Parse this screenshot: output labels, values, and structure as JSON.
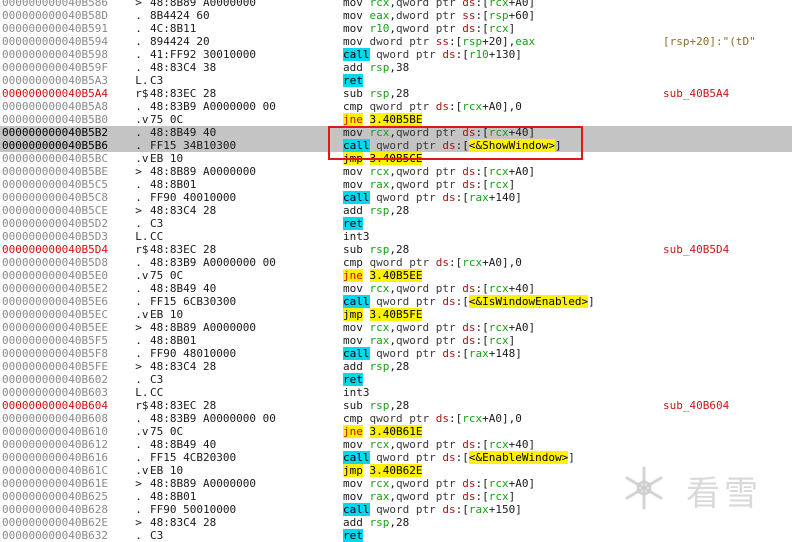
{
  "watermark": "看雪",
  "rows": [
    {
      "addr": "000000000040B586",
      "bytes": "48:8B89 A0000000",
      "g": "  >",
      "asm": [
        [
          "mov",
          "m"
        ],
        [
          " "
        ],
        [
          "rcx",
          "reg"
        ],
        [
          ","
        ],
        [
          "qword ptr ",
          "kw"
        ],
        [
          "ds",
          "seg"
        ],
        [
          ":["
        ],
        [
          "rcx",
          "reg"
        ],
        [
          "+A0]"
        ]
      ]
    },
    {
      "addr": "000000000040B58D",
      "bytes": "8B4424 60",
      "g": "  .",
      "asm": [
        [
          "mov",
          "m"
        ],
        [
          " "
        ],
        [
          "eax",
          "reg"
        ],
        [
          ","
        ],
        [
          "dword ptr ",
          "kw"
        ],
        [
          "ss",
          "seg"
        ],
        [
          ":["
        ],
        [
          "rsp",
          "reg"
        ],
        [
          "+60]"
        ]
      ]
    },
    {
      "addr": "000000000040B591",
      "bytes": "4C:8B11",
      "g": "  .",
      "asm": [
        [
          "mov",
          "m"
        ],
        [
          " "
        ],
        [
          "r10",
          "reg"
        ],
        [
          ","
        ],
        [
          "qword ptr ",
          "kw"
        ],
        [
          "ds",
          "seg"
        ],
        [
          ":["
        ],
        [
          "rcx",
          "reg"
        ],
        [
          "]"
        ]
      ]
    },
    {
      "addr": "000000000040B594",
      "bytes": "894424 20",
      "g": "  .",
      "asm": [
        [
          "mov",
          "m"
        ],
        [
          " "
        ],
        [
          "dword ptr ",
          "kw"
        ],
        [
          "ss",
          "seg"
        ],
        [
          ":["
        ],
        [
          "rsp",
          "reg"
        ],
        [
          "+20],"
        ],
        [
          "eax",
          "reg"
        ]
      ],
      "cmt": "[rsp+20]:\"(tD\""
    },
    {
      "addr": "000000000040B598",
      "bytes": "41:FF92 30010000",
      "g": "  .",
      "asm": [
        [
          "call",
          "call"
        ],
        [
          " "
        ],
        [
          "qword ptr ",
          "kw"
        ],
        [
          "ds",
          "seg"
        ],
        [
          ":["
        ],
        [
          "r10",
          "reg"
        ],
        [
          "+130]"
        ]
      ]
    },
    {
      "addr": "000000000040B59F",
      "bytes": "48:83C4 38",
      "g": "  .",
      "asm": [
        [
          "add",
          "m"
        ],
        [
          " "
        ],
        [
          "rsp",
          "reg"
        ],
        [
          ",38"
        ]
      ]
    },
    {
      "addr": "000000000040B5A3",
      "bytes": "C3",
      "g": "  L.",
      "asm": [
        [
          "ret",
          "ret"
        ]
      ]
    },
    {
      "addr": "000000000040B5A4",
      "bytes": "48:83EC 28",
      "g": "  r$",
      "lbl": true,
      "asm": [
        [
          "sub",
          "m"
        ],
        [
          " "
        ],
        [
          "rsp",
          "reg"
        ],
        [
          ",28"
        ]
      ],
      "cmt": "sub_40B5A4",
      "cmtfn": true
    },
    {
      "addr": "000000000040B5A8",
      "bytes": "48:83B9 A0000000 00",
      "g": "  .",
      "asm": [
        [
          "cmp",
          "m"
        ],
        [
          " "
        ],
        [
          "qword ptr ",
          "kw"
        ],
        [
          "ds",
          "seg"
        ],
        [
          ":["
        ],
        [
          "rcx",
          "reg"
        ],
        [
          "+A0],0"
        ]
      ]
    },
    {
      "addr": "000000000040B5B0",
      "bytes": "75 0C",
      "g": "  .v",
      "asm": [
        [
          "jne",
          "jcc"
        ],
        [
          " "
        ],
        [
          "3.40B5BE",
          "op"
        ]
      ]
    },
    {
      "addr": "000000000040B5B2",
      "bytes": "48:8B49 40",
      "g": "  .",
      "sel": true,
      "asm": [
        [
          "mov",
          "m"
        ],
        [
          " "
        ],
        [
          "rcx",
          "reg"
        ],
        [
          ","
        ],
        [
          "qword ptr ",
          "kw"
        ],
        [
          "ds",
          "seg"
        ],
        [
          ":["
        ],
        [
          "rcx",
          "reg"
        ],
        [
          "+40]"
        ]
      ]
    },
    {
      "addr": "000000000040B5B6",
      "bytes": "FF15 34B10300",
      "g": "  .",
      "sel": true,
      "asm": [
        [
          "call",
          "call"
        ],
        [
          " "
        ],
        [
          "qword ptr ",
          "kw"
        ],
        [
          "ds",
          "seg"
        ],
        [
          ":["
        ],
        [
          "<&ShowWindow>",
          "op"
        ],
        [
          "]"
        ]
      ]
    },
    {
      "addr": "000000000040B5BC",
      "bytes": "EB 10",
      "g": "  .v",
      "asm": [
        [
          "jmp",
          "jmp"
        ],
        [
          " "
        ],
        [
          "3.40B5CE",
          "op"
        ]
      ]
    },
    {
      "addr": "000000000040B5BE",
      "bytes": "48:8B89 A0000000",
      "g": "  >",
      "asm": [
        [
          "mov",
          "m"
        ],
        [
          " "
        ],
        [
          "rcx",
          "reg"
        ],
        [
          ","
        ],
        [
          "qword ptr ",
          "kw"
        ],
        [
          "ds",
          "seg"
        ],
        [
          ":["
        ],
        [
          "rcx",
          "reg"
        ],
        [
          "+A0]"
        ]
      ]
    },
    {
      "addr": "000000000040B5C5",
      "bytes": "48:8B01",
      "g": "  .",
      "asm": [
        [
          "mov",
          "m"
        ],
        [
          " "
        ],
        [
          "rax",
          "reg"
        ],
        [
          ","
        ],
        [
          "qword ptr ",
          "kw"
        ],
        [
          "ds",
          "seg"
        ],
        [
          ":["
        ],
        [
          "rcx",
          "reg"
        ],
        [
          "]"
        ]
      ]
    },
    {
      "addr": "000000000040B5C8",
      "bytes": "FF90 40010000",
      "g": "  .",
      "asm": [
        [
          "call",
          "call"
        ],
        [
          " "
        ],
        [
          "qword ptr ",
          "kw"
        ],
        [
          "ds",
          "seg"
        ],
        [
          ":["
        ],
        [
          "rax",
          "reg"
        ],
        [
          "+140]"
        ]
      ]
    },
    {
      "addr": "000000000040B5CE",
      "bytes": "48:83C4 28",
      "g": "  >",
      "asm": [
        [
          "add",
          "m"
        ],
        [
          " "
        ],
        [
          "rsp",
          "reg"
        ],
        [
          ",28"
        ]
      ]
    },
    {
      "addr": "000000000040B5D2",
      "bytes": "C3",
      "g": "  .",
      "asm": [
        [
          "ret",
          "ret"
        ]
      ]
    },
    {
      "addr": "000000000040B5D3",
      "bytes": "CC",
      "g": "  L.",
      "asm": [
        [
          "int3",
          "m"
        ]
      ]
    },
    {
      "addr": "000000000040B5D4",
      "bytes": "48:83EC 28",
      "g": "  r$",
      "lbl": true,
      "asm": [
        [
          "sub",
          "m"
        ],
        [
          " "
        ],
        [
          "rsp",
          "reg"
        ],
        [
          ",28"
        ]
      ],
      "cmt": "sub_40B5D4",
      "cmtfn": true
    },
    {
      "addr": "000000000040B5D8",
      "bytes": "48:83B9 A0000000 00",
      "g": "  .",
      "asm": [
        [
          "cmp",
          "m"
        ],
        [
          " "
        ],
        [
          "qword ptr ",
          "kw"
        ],
        [
          "ds",
          "seg"
        ],
        [
          ":["
        ],
        [
          "rcx",
          "reg"
        ],
        [
          "+A0],0"
        ]
      ]
    },
    {
      "addr": "000000000040B5E0",
      "bytes": "75 0C",
      "g": "  .v",
      "asm": [
        [
          "jne",
          "jcc"
        ],
        [
          " "
        ],
        [
          "3.40B5EE",
          "op"
        ]
      ]
    },
    {
      "addr": "000000000040B5E2",
      "bytes": "48:8B49 40",
      "g": "  .",
      "asm": [
        [
          "mov",
          "m"
        ],
        [
          " "
        ],
        [
          "rcx",
          "reg"
        ],
        [
          ","
        ],
        [
          "qword ptr ",
          "kw"
        ],
        [
          "ds",
          "seg"
        ],
        [
          ":["
        ],
        [
          "rcx",
          "reg"
        ],
        [
          "+40]"
        ]
      ]
    },
    {
      "addr": "000000000040B5E6",
      "bytes": "FF15 6CB30300",
      "g": "  .",
      "asm": [
        [
          "call",
          "call"
        ],
        [
          " "
        ],
        [
          "qword ptr ",
          "kw"
        ],
        [
          "ds",
          "seg"
        ],
        [
          ":["
        ],
        [
          "<&IsWindowEnabled>",
          "op"
        ],
        [
          "]"
        ]
      ]
    },
    {
      "addr": "000000000040B5EC",
      "bytes": "EB 10",
      "g": "  .v",
      "asm": [
        [
          "jmp",
          "jmp"
        ],
        [
          " "
        ],
        [
          "3.40B5FE",
          "op"
        ]
      ]
    },
    {
      "addr": "000000000040B5EE",
      "bytes": "48:8B89 A0000000",
      "g": "  >",
      "asm": [
        [
          "mov",
          "m"
        ],
        [
          " "
        ],
        [
          "rcx",
          "reg"
        ],
        [
          ","
        ],
        [
          "qword ptr ",
          "kw"
        ],
        [
          "ds",
          "seg"
        ],
        [
          ":["
        ],
        [
          "rcx",
          "reg"
        ],
        [
          "+A0]"
        ]
      ]
    },
    {
      "addr": "000000000040B5F5",
      "bytes": "48:8B01",
      "g": "  .",
      "asm": [
        [
          "mov",
          "m"
        ],
        [
          " "
        ],
        [
          "rax",
          "reg"
        ],
        [
          ","
        ],
        [
          "qword ptr ",
          "kw"
        ],
        [
          "ds",
          "seg"
        ],
        [
          ":["
        ],
        [
          "rcx",
          "reg"
        ],
        [
          "]"
        ]
      ]
    },
    {
      "addr": "000000000040B5F8",
      "bytes": "FF90 48010000",
      "g": "  .",
      "asm": [
        [
          "call",
          "call"
        ],
        [
          " "
        ],
        [
          "qword ptr ",
          "kw"
        ],
        [
          "ds",
          "seg"
        ],
        [
          ":["
        ],
        [
          "rax",
          "reg"
        ],
        [
          "+148]"
        ]
      ]
    },
    {
      "addr": "000000000040B5FE",
      "bytes": "48:83C4 28",
      "g": "  >",
      "asm": [
        [
          "add",
          "m"
        ],
        [
          " "
        ],
        [
          "rsp",
          "reg"
        ],
        [
          ",28"
        ]
      ]
    },
    {
      "addr": "000000000040B602",
      "bytes": "C3",
      "g": "  .",
      "asm": [
        [
          "ret",
          "ret"
        ]
      ]
    },
    {
      "addr": "000000000040B603",
      "bytes": "CC",
      "g": "  L.",
      "asm": [
        [
          "int3",
          "m"
        ]
      ]
    },
    {
      "addr": "000000000040B604",
      "bytes": "48:83EC 28",
      "g": "  r$",
      "lbl": true,
      "asm": [
        [
          "sub",
          "m"
        ],
        [
          " "
        ],
        [
          "rsp",
          "reg"
        ],
        [
          ",28"
        ]
      ],
      "cmt": "sub_40B604",
      "cmtfn": true
    },
    {
      "addr": "000000000040B608",
      "bytes": "48:83B9 A0000000 00",
      "g": "  .",
      "asm": [
        [
          "cmp",
          "m"
        ],
        [
          " "
        ],
        [
          "qword ptr ",
          "kw"
        ],
        [
          "ds",
          "seg"
        ],
        [
          ":["
        ],
        [
          "rcx",
          "reg"
        ],
        [
          "+A0],0"
        ]
      ]
    },
    {
      "addr": "000000000040B610",
      "bytes": "75 0C",
      "g": "  .v",
      "asm": [
        [
          "jne",
          "jcc"
        ],
        [
          " "
        ],
        [
          "3.40B61E",
          "op"
        ]
      ]
    },
    {
      "addr": "000000000040B612",
      "bytes": "48:8B49 40",
      "g": "  .",
      "asm": [
        [
          "mov",
          "m"
        ],
        [
          " "
        ],
        [
          "rcx",
          "reg"
        ],
        [
          ","
        ],
        [
          "qword ptr ",
          "kw"
        ],
        [
          "ds",
          "seg"
        ],
        [
          ":["
        ],
        [
          "rcx",
          "reg"
        ],
        [
          "+40]"
        ]
      ]
    },
    {
      "addr": "000000000040B616",
      "bytes": "FF15 4CB20300",
      "g": "  .",
      "asm": [
        [
          "call",
          "call"
        ],
        [
          " "
        ],
        [
          "qword ptr ",
          "kw"
        ],
        [
          "ds",
          "seg"
        ],
        [
          ":["
        ],
        [
          "<&EnableWindow>",
          "op"
        ],
        [
          "]"
        ]
      ]
    },
    {
      "addr": "000000000040B61C",
      "bytes": "EB 10",
      "g": "  .v",
      "asm": [
        [
          "jmp",
          "jmp"
        ],
        [
          " "
        ],
        [
          "3.40B62E",
          "op"
        ]
      ]
    },
    {
      "addr": "000000000040B61E",
      "bytes": "48:8B89 A0000000",
      "g": "  >",
      "asm": [
        [
          "mov",
          "m"
        ],
        [
          " "
        ],
        [
          "rcx",
          "reg"
        ],
        [
          ","
        ],
        [
          "qword ptr ",
          "kw"
        ],
        [
          "ds",
          "seg"
        ],
        [
          ":["
        ],
        [
          "rcx",
          "reg"
        ],
        [
          "+A0]"
        ]
      ]
    },
    {
      "addr": "000000000040B625",
      "bytes": "48:8B01",
      "g": "  .",
      "asm": [
        [
          "mov",
          "m"
        ],
        [
          " "
        ],
        [
          "rax",
          "reg"
        ],
        [
          ","
        ],
        [
          "qword ptr ",
          "kw"
        ],
        [
          "ds",
          "seg"
        ],
        [
          ":["
        ],
        [
          "rcx",
          "reg"
        ],
        [
          "]"
        ]
      ]
    },
    {
      "addr": "000000000040B628",
      "bytes": "FF90 50010000",
      "g": "  .",
      "asm": [
        [
          "call",
          "call"
        ],
        [
          " "
        ],
        [
          "qword ptr ",
          "kw"
        ],
        [
          "ds",
          "seg"
        ],
        [
          ":["
        ],
        [
          "rax",
          "reg"
        ],
        [
          "+150]"
        ]
      ]
    },
    {
      "addr": "000000000040B62E",
      "bytes": "48:83C4 28",
      "g": "  >",
      "asm": [
        [
          "add",
          "m"
        ],
        [
          " "
        ],
        [
          "rsp",
          "reg"
        ],
        [
          ",28"
        ]
      ]
    },
    {
      "addr": "000000000040B632",
      "bytes": "C3",
      "g": "  .",
      "asm": [
        [
          "ret",
          "ret"
        ]
      ]
    }
  ]
}
